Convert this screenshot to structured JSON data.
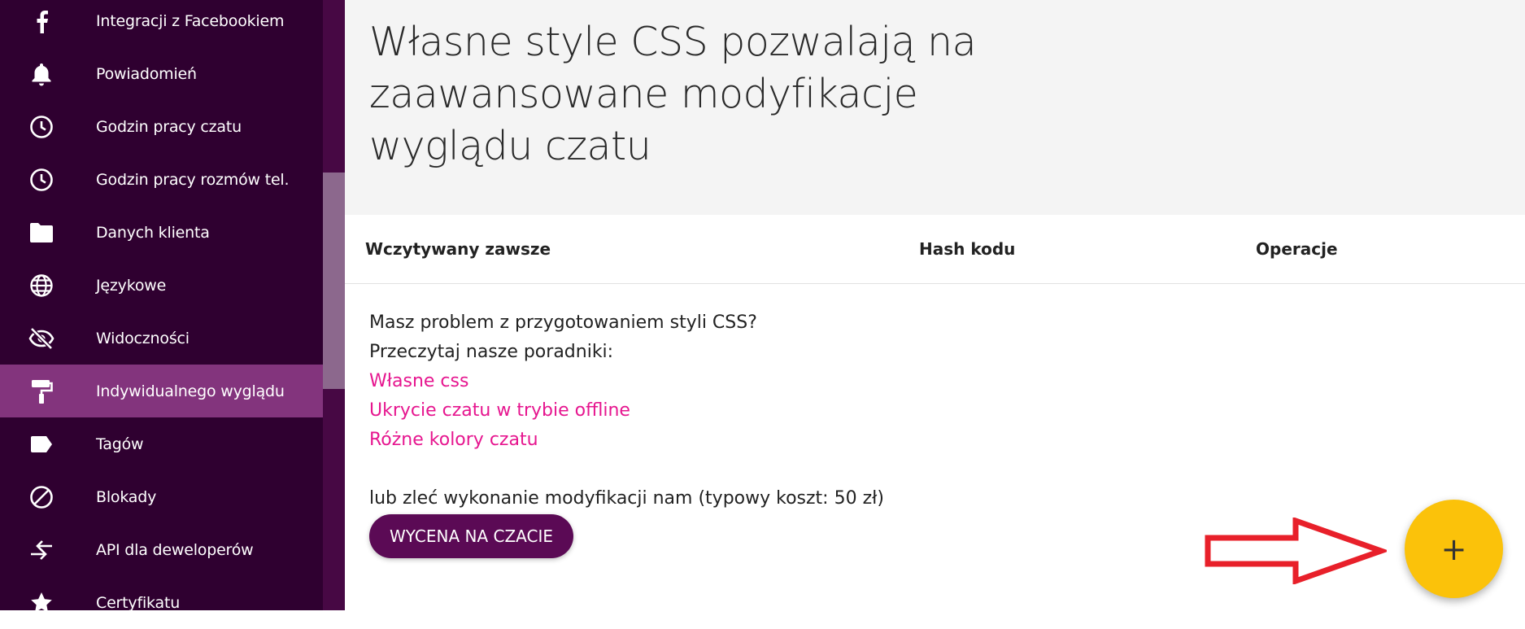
{
  "sidebar": {
    "items": [
      {
        "label": "Integracji z Facebookiem",
        "icon": "facebook-icon"
      },
      {
        "label": "Powiadomień",
        "icon": "bell-icon"
      },
      {
        "label": "Godzin pracy czatu",
        "icon": "clock-icon"
      },
      {
        "label": "Godzin pracy rozmów tel.",
        "icon": "clock-icon"
      },
      {
        "label": "Danych klienta",
        "icon": "folder-icon"
      },
      {
        "label": "Językowe",
        "icon": "globe-icon"
      },
      {
        "label": "Widoczności",
        "icon": "eye-off-icon"
      },
      {
        "label": "Indywidualnego wyglądu",
        "icon": "paint-roller-icon",
        "active": true
      },
      {
        "label": "Tagów",
        "icon": "tag-icon"
      },
      {
        "label": "Blokady",
        "icon": "block-icon"
      },
      {
        "label": "API dla deweloperów",
        "icon": "swap-arrows-icon"
      },
      {
        "label": "Certyfikatu",
        "icon": "star-icon"
      }
    ]
  },
  "header": {
    "title": "Własne style CSS pozwalają na zaawansowane modyfikacje wyglądu czatu"
  },
  "table": {
    "columns": [
      "Wczytywany zawsze",
      "Hash kodu",
      "Operacje"
    ]
  },
  "help": {
    "problem": "Masz problem z przygotowaniem styli CSS?",
    "read_guides": "Przeczytaj nasze poradniki:",
    "links": [
      "Własne css",
      "Ukrycie czatu w trybie offline",
      "Różne kolory czatu"
    ],
    "or_order": "lub zleć wykonanie modyfikacji nam (typowy koszt: 50 zł)",
    "quote_button": "WYCENA NA CZACIE"
  },
  "fab": {
    "label": "+",
    "icon": "plus-icon"
  },
  "colors": {
    "sidebar_bg": "#2f0030",
    "sidebar_active": "#83347d",
    "link": "#e6168f",
    "button": "#5b0a55",
    "fab": "#fbc20a",
    "arrow": "#e8202a"
  }
}
